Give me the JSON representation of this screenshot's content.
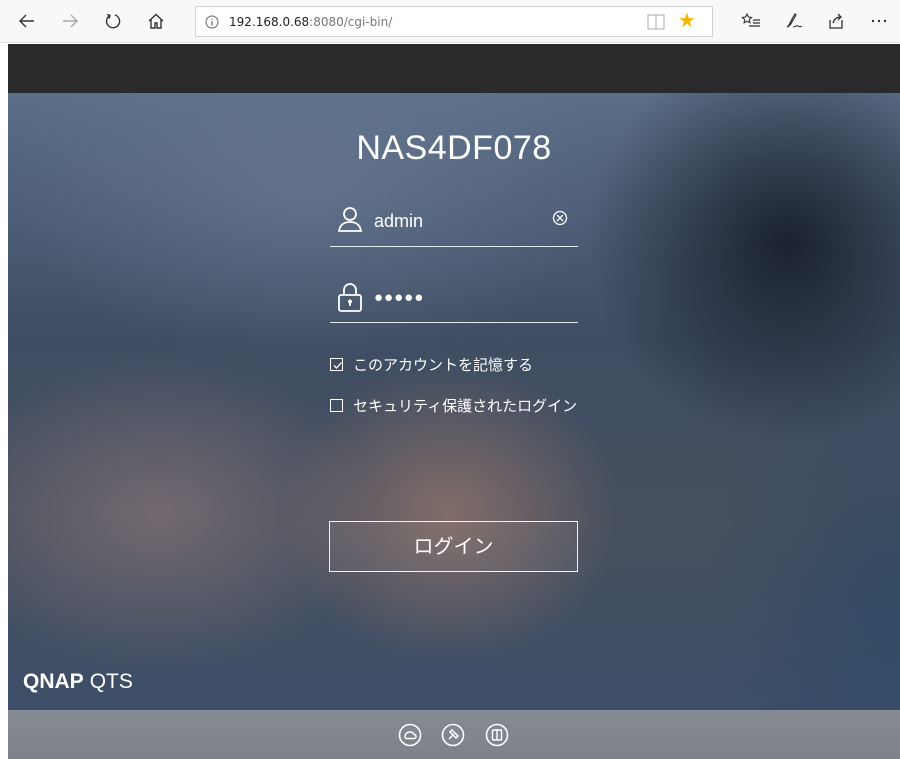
{
  "browser": {
    "url_host": "192.168.0.68",
    "url_rest": ":8080/cgi-bin/",
    "icons": [
      "back-icon",
      "forward-icon",
      "refresh-icon",
      "home-icon",
      "info-icon",
      "reading-view-icon",
      "favorite-star-icon",
      "favorites-list-icon",
      "pen-icon",
      "share-icon",
      "more-icon"
    ],
    "star_color": "#f2b806"
  },
  "login": {
    "hostname": "NAS4DF078",
    "username": "admin",
    "password_mask": "●●●●●",
    "remember_label": "このアカウントを記憶する",
    "remember_checked": true,
    "secure_label": "セキュリティ保護されたログイン",
    "secure_checked": false,
    "login_button": "ログイン"
  },
  "brand": {
    "name": "QNAP",
    "product": "QTS"
  },
  "footer": {
    "icons": [
      "qfinder-icon",
      "tools-icon",
      "app-icon"
    ]
  }
}
